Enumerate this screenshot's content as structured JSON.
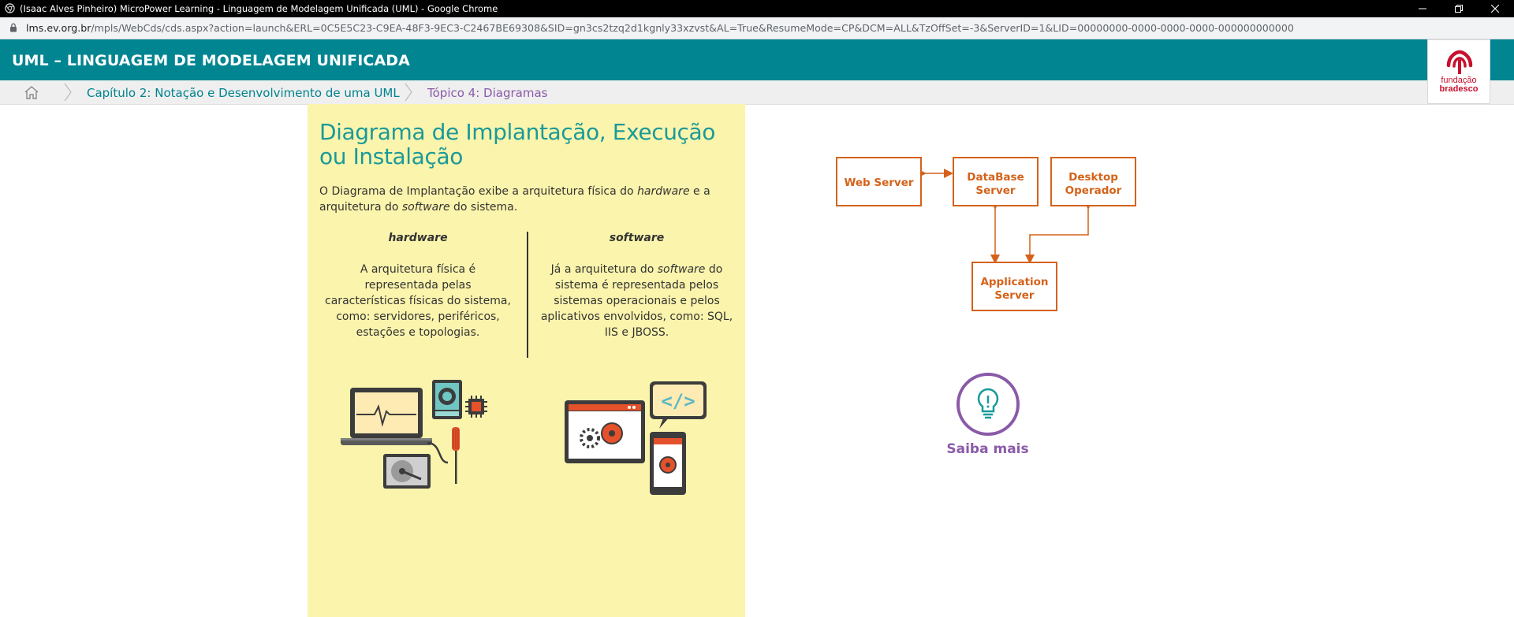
{
  "browser": {
    "window_title": "(Isaac Alves Pinheiro) MicroPower Learning - Linguagem de Modelagem Unificada (UML) - Google Chrome",
    "url_host": "lms.ev.org.br",
    "url_path": "/mpls/WebCds/cds.aspx?action=launch&ERL=0C5E5C23-C9EA-48F3-9EC3-C2467BE69308&SID=gn3cs2tzq2d1kgnly33xzvst&AL=True&ResumeMode=CP&DCM=ALL&TzOffSet=-3&ServerID=1&LID=00000000-0000-0000-0000-000000000000",
    "controls": {
      "minimize": "minimize-icon",
      "restore": "restore-icon",
      "close": "close-icon"
    }
  },
  "header": {
    "course_title": "UML – LINGUAGEM DE MODELAGEM UNIFICADA",
    "logo": {
      "line1": "fundação",
      "line2": "bradesco",
      "color": "#c8102e"
    },
    "background": "#008591"
  },
  "breadcrumb": {
    "home_icon": "home-icon",
    "items": [
      {
        "label": "Capítulo 2: Notação e Desenvolvimento de uma UML"
      },
      {
        "label": "Tópico 4: Diagramas"
      }
    ]
  },
  "content": {
    "title": "Diagrama de Implantação, Execução ou Instalação",
    "intro": {
      "part1": "O Diagrama de Implantação exibe a arquitetura física do ",
      "em1": "hardware",
      "part2": " e a arquitetura do ",
      "em2": "software",
      "part3": " do sistema."
    },
    "hardware": {
      "title": "hardware",
      "text": "A arquitetura física é representada pelas características físicas do sistema, como: servidores, periféricos, estações e topologias."
    },
    "software": {
      "title": "software",
      "text_part1": "Já a arquitetura do ",
      "text_em": "software",
      "text_part2": " do sistema é representada pelos sistemas operacionais e pelos aplicativos envolvidos, como: SQL, IIS e JBOSS."
    },
    "panel_color": "#fbf4ac",
    "title_color": "#1a9a99"
  },
  "diagram": {
    "nodes": {
      "web_server": [
        "Web Server"
      ],
      "database_server": [
        "DataBase",
        "Server"
      ],
      "desktop_operador": [
        "Desktop",
        "Operador"
      ],
      "application_server": [
        "Application",
        "Server"
      ]
    },
    "edges": [
      [
        "Web Server",
        "DataBase Server"
      ],
      [
        "DataBase Server",
        "Application Server"
      ],
      [
        "Desktop Operador",
        "Application Server"
      ]
    ],
    "color": "#d4621a"
  },
  "saiba_mais": {
    "label": "Saiba mais",
    "icon": "lightbulb-icon",
    "color": "#8a5aa8"
  }
}
